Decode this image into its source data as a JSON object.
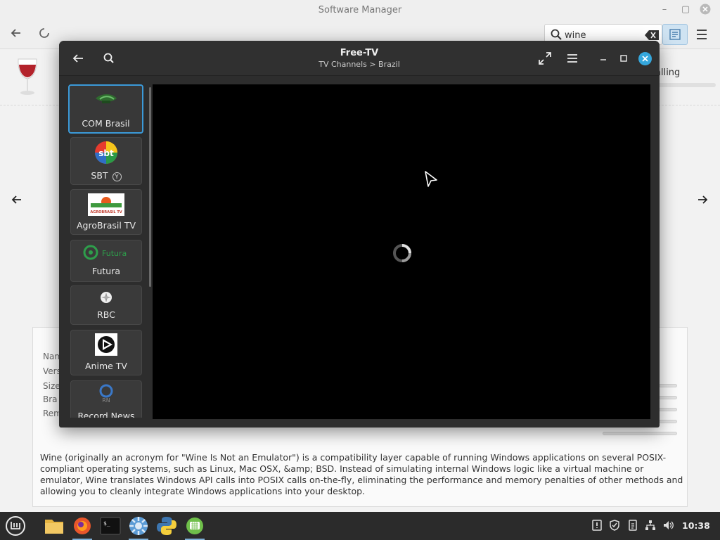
{
  "software_manager": {
    "title": "Software Manager",
    "search": {
      "value": "wine"
    },
    "app": {
      "status_text": "alling"
    },
    "details": {
      "labels": [
        "Nam",
        "Vers",
        "Size",
        "Bra",
        "Rem"
      ],
      "description": "Wine (originally an acronym for \"Wine Is Not an Emulator\") is a compatibility layer capable of running Windows applications on several POSIX-compliant operating systems, such as Linux, Mac OSX, &amp; BSD. Instead of simulating internal Windows logic like a virtual machine or emulator, Wine translates Windows API calls into POSIX calls on-the-fly, eliminating the performance and memory penalties of other methods and allowing you to cleanly integrate Windows applications into your desktop."
    }
  },
  "free_tv": {
    "title": "Free-TV",
    "breadcrumb": "TV Channels > Brazil",
    "channels": [
      {
        "name": "COM Brasil",
        "selected": true
      },
      {
        "name": "SBT",
        "badge": "Y"
      },
      {
        "name": "AgroBrasil TV",
        "logo_text": "AGROBRASIL TV"
      },
      {
        "name": "Futura",
        "logo_text": "Futura"
      },
      {
        "name": "RBC"
      },
      {
        "name": "Anime TV"
      },
      {
        "name": "Record News"
      }
    ],
    "player": {
      "state": "loading"
    }
  },
  "taskbar": {
    "apps": [
      "menu-icon",
      "files-icon",
      "firefox-icon",
      "terminal-icon",
      "settings-icon",
      "python-icon",
      "freetv-icon"
    ],
    "clock": "10:38"
  },
  "colors": {
    "accent": "#35a7dc",
    "selection_border": "#3b9ad9"
  }
}
